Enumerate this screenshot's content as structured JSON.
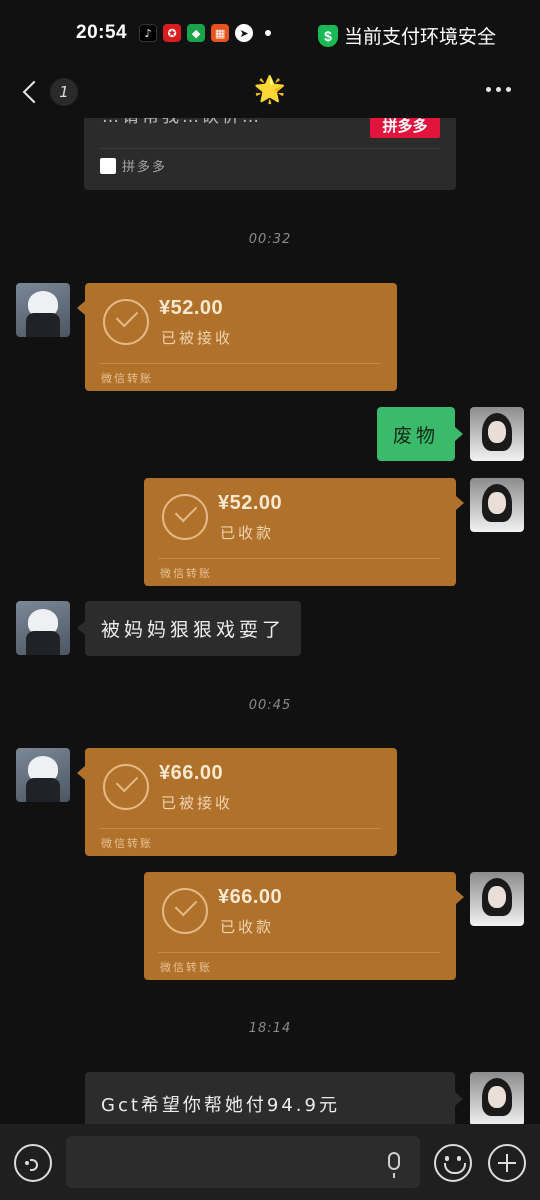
{
  "status_bar": {
    "time": "20:54",
    "secure_text": "当前支付环境安全",
    "shield_symbol": "$",
    "app_icons": [
      {
        "name": "tiktok-icon",
        "glyph": "♪",
        "color": "#000000"
      },
      {
        "name": "bank-app-icon",
        "glyph": "✪",
        "color": "#d81e1e"
      },
      {
        "name": "shield-app-icon",
        "glyph": "◆",
        "color": "#1aa34a"
      },
      {
        "name": "grid-app-icon",
        "glyph": "▦",
        "color": "#e8531f"
      },
      {
        "name": "telegram-icon",
        "glyph": "➤",
        "color": "#ffffff"
      }
    ]
  },
  "nav": {
    "back_count": "1",
    "title": "🌟",
    "more": "more-icon"
  },
  "shared_card": {
    "partial_text": "…请帮我…砍价…",
    "thumb_text": "拼多多",
    "source": "拼多多"
  },
  "timestamps": [
    "00:32",
    "00:45",
    "18:14"
  ],
  "messages": {
    "transfer1": {
      "amount": "¥52.00",
      "status": "已被接收",
      "footer": "微信转账"
    },
    "text_waste": "废物",
    "transfer2": {
      "amount": "¥52.00",
      "status": "已收款",
      "footer": "微信转账"
    },
    "text_mom": "被妈妈狠狠戏耍了",
    "transfer3": {
      "amount": "¥66.00",
      "status": "已被接收",
      "footer": "微信转账"
    },
    "transfer4": {
      "amount": "¥66.00",
      "status": "已收款",
      "footer": "微信转账"
    },
    "text_pay": "Gct希望你帮她付94.9元"
  },
  "input": {
    "value": "",
    "placeholder": ""
  },
  "colors": {
    "background": "#111111",
    "transfer": "#b0712b",
    "sent_bubble": "#3bba6b",
    "received_bubble": "#2c2c2c",
    "secure_green": "#19b955"
  }
}
